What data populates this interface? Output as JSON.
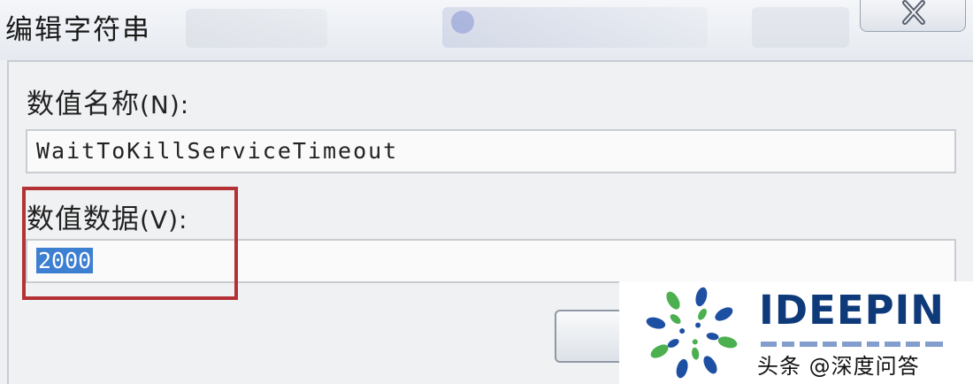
{
  "dialog": {
    "title": "编辑字符串"
  },
  "fields": {
    "value_name_label": "数值名称",
    "value_name_mnemonic": "(N):",
    "value_name": "WaitToKillServiceTimeout",
    "value_data_label": "数值数据",
    "value_data_mnemonic": "(V):",
    "value_data": "2000"
  },
  "watermark": {
    "brand": "IDEEPIN",
    "credit": "头条 @深度问答"
  },
  "colors": {
    "highlight_box": "#b43236",
    "selection": "#3d7fd1",
    "brand_blue": "#0f3a7a",
    "brand_green": "#4caf50"
  },
  "icons": {
    "close": "close-icon",
    "logo": "ideepin-logo-icon"
  }
}
